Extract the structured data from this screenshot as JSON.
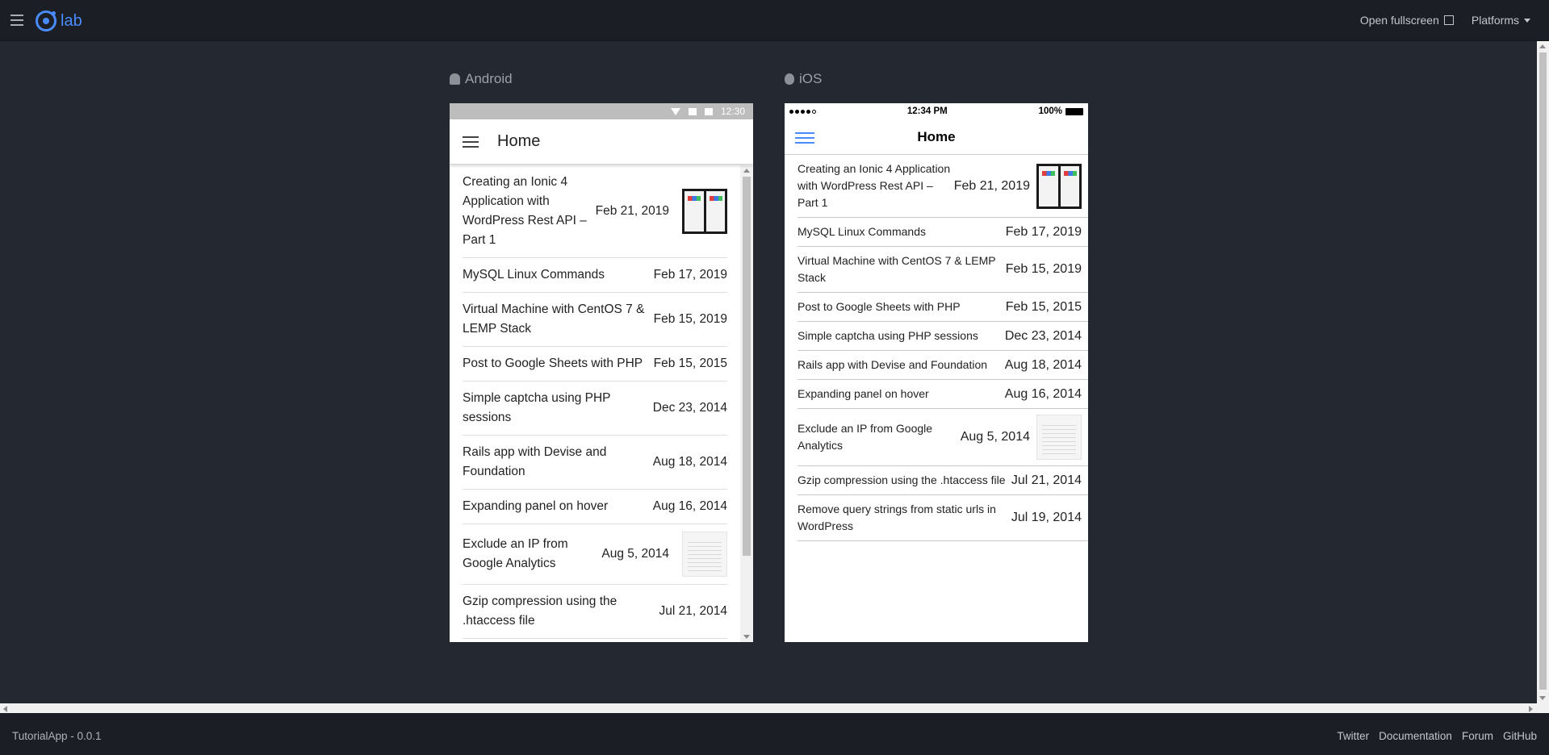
{
  "topbar": {
    "logo_text": "lab",
    "open_fullscreen": "Open fullscreen",
    "platforms": "Platforms"
  },
  "android": {
    "label": "Android",
    "status_time": "12:30",
    "title": "Home",
    "items": [
      {
        "title": "Creating an Ionic 4 Application with WordPress Rest API – Part 1",
        "date": "Feb 21, 2019",
        "thumbnail": "dark"
      },
      {
        "title": "MySQL Linux Commands",
        "date": "Feb 17, 2019",
        "thumbnail": ""
      },
      {
        "title": "Virtual Machine with CentOS 7 & LEMP Stack",
        "date": "Feb 15, 2019",
        "thumbnail": ""
      },
      {
        "title": "Post to Google Sheets with PHP",
        "date": "Feb 15, 2015",
        "thumbnail": ""
      },
      {
        "title": "Simple captcha using PHP sessions",
        "date": "Dec 23, 2014",
        "thumbnail": ""
      },
      {
        "title": "Rails app with Devise and Foundation",
        "date": "Aug 18, 2014",
        "thumbnail": ""
      },
      {
        "title": "Expanding panel on hover",
        "date": "Aug 16, 2014",
        "thumbnail": ""
      },
      {
        "title": "Exclude an IP from Google Analytics",
        "date": "Aug 5, 2014",
        "thumbnail": "light"
      },
      {
        "title": "Gzip compression using the .htaccess file",
        "date": "Jul 21, 2014",
        "thumbnail": ""
      }
    ]
  },
  "ios": {
    "label": "iOS",
    "status_time": "12:34 PM",
    "battery": "100%",
    "title": "Home",
    "items": [
      {
        "title": "Creating an Ionic 4 Application with WordPress Rest API – Part 1",
        "date": "Feb 21, 2019",
        "thumbnail": "dark"
      },
      {
        "title": "MySQL Linux Commands",
        "date": "Feb 17, 2019",
        "thumbnail": ""
      },
      {
        "title": "Virtual Machine with CentOS 7 & LEMP Stack",
        "date": "Feb 15, 2019",
        "thumbnail": ""
      },
      {
        "title": "Post to Google Sheets with PHP",
        "date": "Feb 15, 2015",
        "thumbnail": ""
      },
      {
        "title": "Simple captcha using PHP sessions",
        "date": "Dec 23, 2014",
        "thumbnail": ""
      },
      {
        "title": "Rails app with Devise and Foundation",
        "date": "Aug 18, 2014",
        "thumbnail": ""
      },
      {
        "title": "Expanding panel on hover",
        "date": "Aug 16, 2014",
        "thumbnail": ""
      },
      {
        "title": "Exclude an IP from Google Analytics",
        "date": "Aug 5, 2014",
        "thumbnail": "light"
      },
      {
        "title": "Gzip compression using the .htaccess file",
        "date": "Jul 21, 2014",
        "thumbnail": ""
      },
      {
        "title": "Remove query strings from static urls in WordPress",
        "date": "Jul 19, 2014",
        "thumbnail": ""
      }
    ]
  },
  "footer": {
    "app_version": "TutorialApp - 0.0.1",
    "links": [
      "Twitter",
      "Documentation",
      "Forum",
      "GitHub"
    ]
  },
  "colors": {
    "accent": "#4a8bfc",
    "background": "#242931",
    "bar": "#1b1f25"
  }
}
